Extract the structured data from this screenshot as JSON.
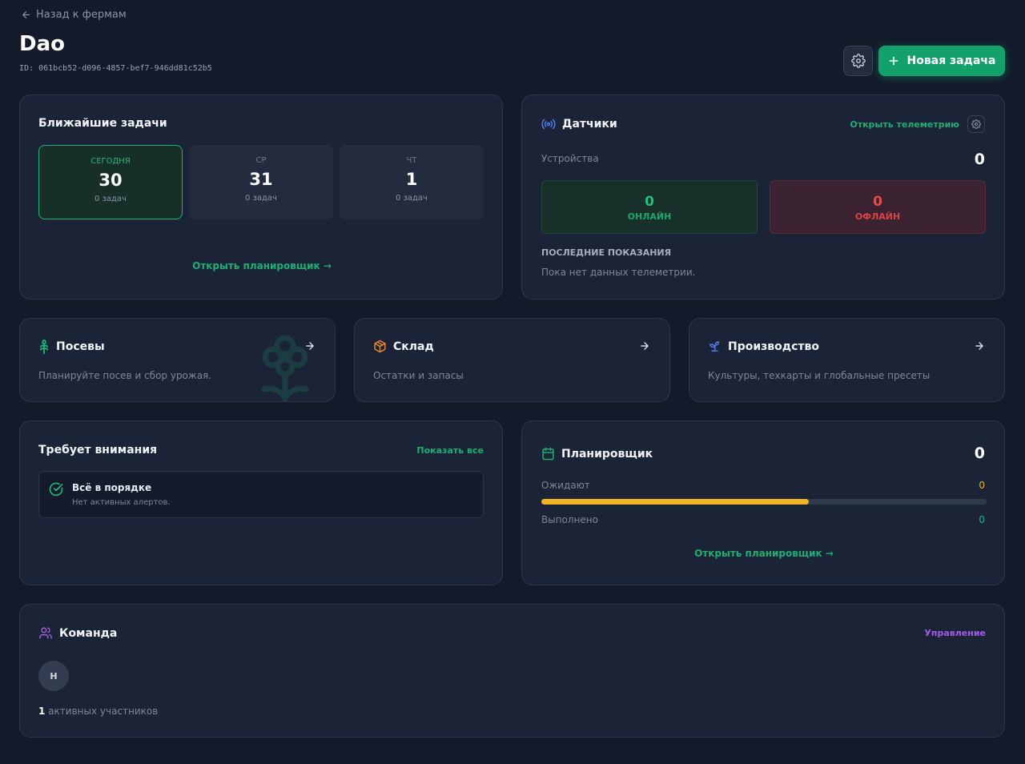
{
  "header": {
    "back_label": "Назад к фермам",
    "title": "Dao",
    "farm_id": "ID: 061bcb52-d096-4857-bef7-946dd81c52b5",
    "new_task_label": "Новая задача"
  },
  "upcoming": {
    "title": "Ближайшие задачи",
    "days": [
      {
        "name": "СЕГОДНЯ",
        "number": "30",
        "tasks": "0 задач"
      },
      {
        "name": "СР",
        "number": "31",
        "tasks": "0 задач"
      },
      {
        "name": "ЧТ",
        "number": "1",
        "tasks": "0 задач"
      }
    ],
    "open_planner_label": "Открыть планировщик →"
  },
  "sensors": {
    "title": "Датчики",
    "open_telemetry_label": "Открыть телеметрию",
    "devices_label": "Устройства",
    "devices_count": "0",
    "online_count": "0",
    "online_label": "ОНЛАЙН",
    "offline_count": "0",
    "offline_label": "ОФЛАЙН",
    "last_readings_label": "ПОСЛЕДНИЕ ПОКАЗАНИЯ",
    "no_data_label": "Пока нет данных телеметрии."
  },
  "nav_cards": [
    {
      "title": "Посевы",
      "subtitle": "Планируйте посев и сбор урожая."
    },
    {
      "title": "Склад",
      "subtitle": "Остатки и запасы"
    },
    {
      "title": "Производство",
      "subtitle": "Культуры, техкарты и глобальные пресеты"
    }
  ],
  "attention": {
    "title": "Требует внимания",
    "show_all_label": "Показать все",
    "ok_title": "Всё в порядке",
    "ok_subtitle": "Нет активных алертов."
  },
  "planner": {
    "title": "Планировщик",
    "total": "0",
    "pending_label": "Ожидают",
    "pending_value": "0",
    "pending_fraction": 0.6,
    "done_label": "Выполнено",
    "done_value": "0",
    "open_planner_label": "Открыть планировщик →"
  },
  "team": {
    "title": "Команда",
    "manage_label": "Управление",
    "member_initial": "Н",
    "active_count": "1",
    "active_label": "активных участников"
  },
  "colors": {
    "accent_green": "#12a06b",
    "warning_yellow": "#f1b320",
    "offline_red": "#e04646",
    "team_purple": "#a25be8"
  }
}
